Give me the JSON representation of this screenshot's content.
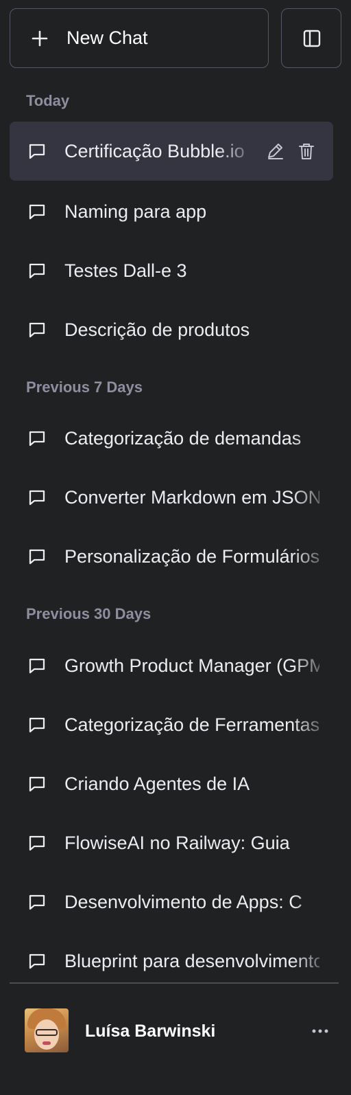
{
  "header": {
    "new_chat_label": "New Chat",
    "new_chat_icon": "plus-icon",
    "toggle_icon": "sidebar-toggle-icon"
  },
  "sections": [
    {
      "label": "Today",
      "items": [
        {
          "title": "Certificação Bubble.io",
          "active": true
        },
        {
          "title": "Naming para app"
        },
        {
          "title": "Testes Dall-e 3"
        },
        {
          "title": "Descrição de produtos"
        }
      ]
    },
    {
      "label": "Previous 7 Days",
      "items": [
        {
          "title": "Categorização de demandas"
        },
        {
          "title": "Converter Markdown em JSON"
        },
        {
          "title": "Personalização de Formulários"
        }
      ]
    },
    {
      "label": "Previous 30 Days",
      "items": [
        {
          "title": "Growth Product Manager (GPM)"
        },
        {
          "title": "Categorização de Ferramentas"
        },
        {
          "title": "Criando Agentes de IA"
        },
        {
          "title": "FlowiseAI no Railway: Guia"
        },
        {
          "title": "Desenvolvimento de Apps: C"
        },
        {
          "title": "Blueprint para desenvolvimento"
        }
      ]
    }
  ],
  "user": {
    "name": "Luísa Barwinski"
  },
  "colors": {
    "background": "#202123",
    "active_item": "#343541",
    "section_label": "#8e8ea0",
    "border": "#565869"
  }
}
